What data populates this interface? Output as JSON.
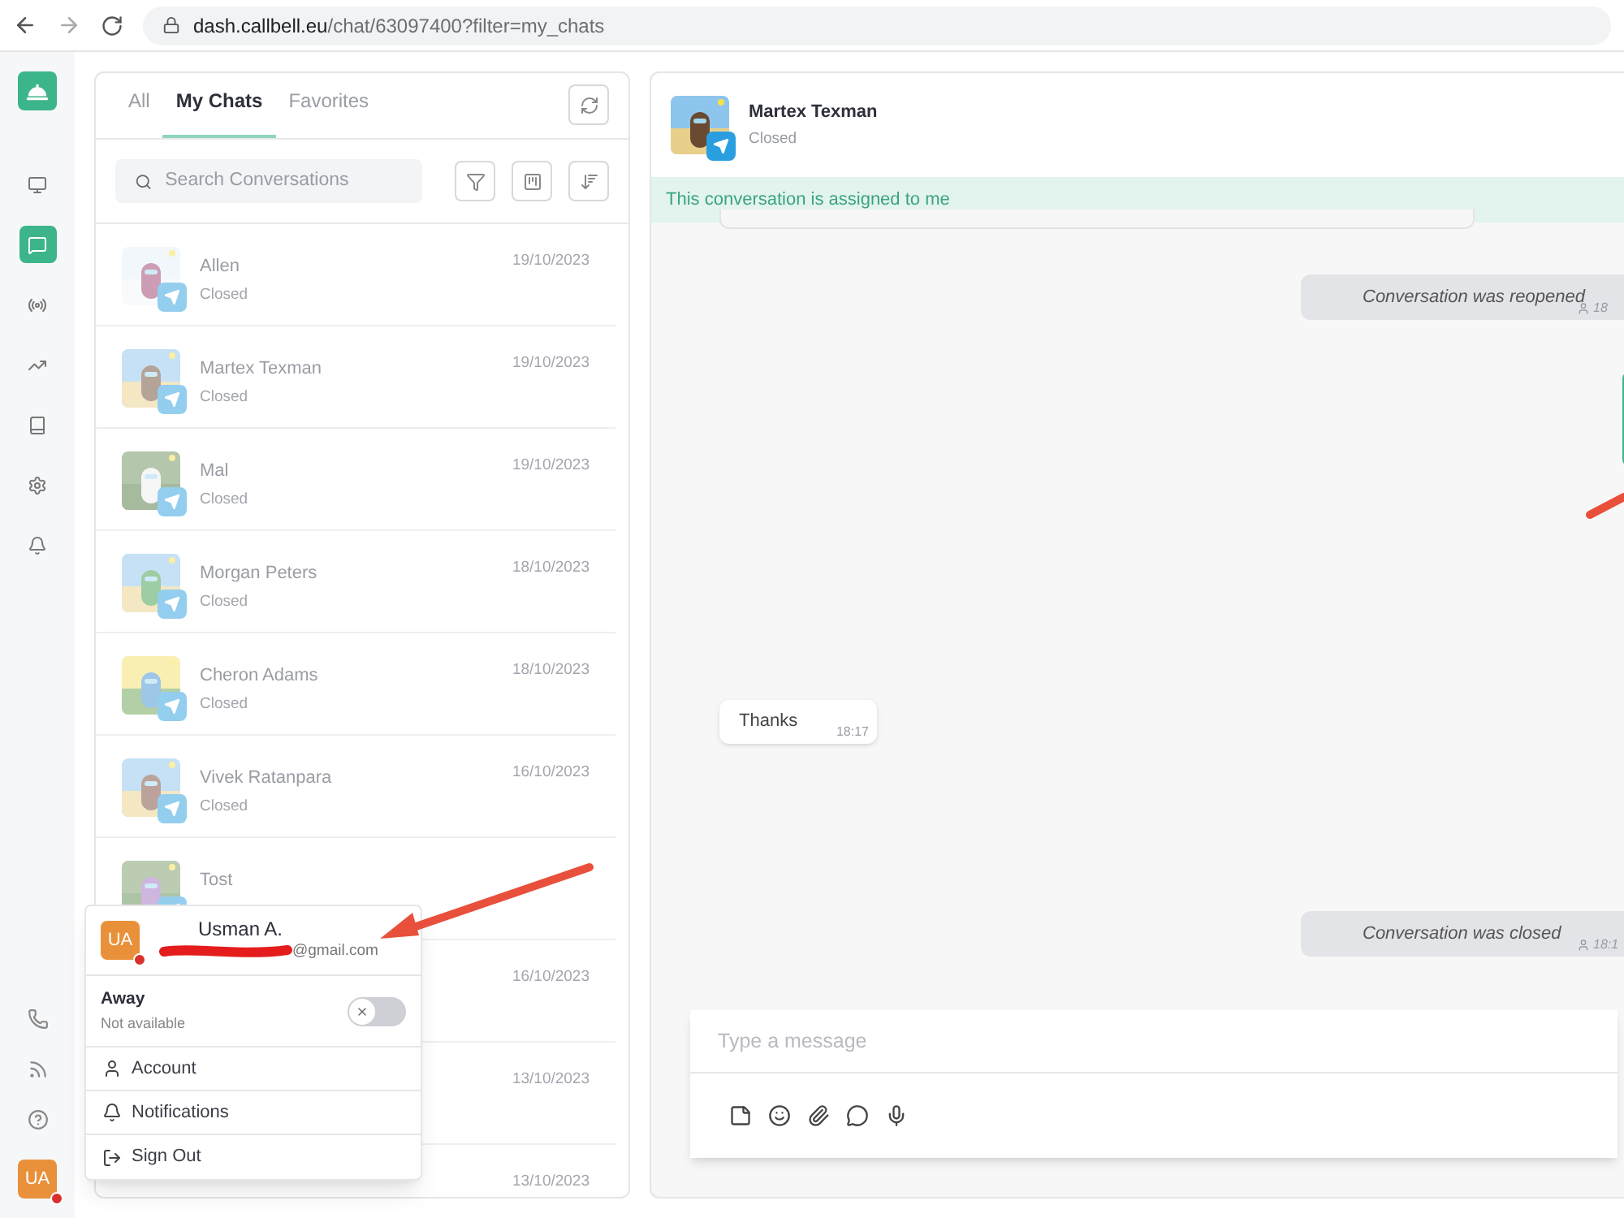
{
  "browser": {
    "url_host": "dash.callbell.eu",
    "url_path": "/chat/63097400?filter=my_chats"
  },
  "nav": {
    "top": [
      {
        "kind": "monitor",
        "selected": false
      },
      {
        "kind": "chat",
        "selected": true
      },
      {
        "kind": "broadcast",
        "selected": false
      },
      {
        "kind": "trend",
        "selected": false
      },
      {
        "kind": "book",
        "selected": false
      },
      {
        "kind": "settings",
        "selected": false
      },
      {
        "kind": "bell",
        "selected": false
      }
    ],
    "bottom": [
      {
        "kind": "whatsapp"
      },
      {
        "kind": "rss"
      },
      {
        "kind": "help"
      }
    ],
    "avatar_initials": "UA"
  },
  "tabs": [
    {
      "label": "All",
      "selected": false
    },
    {
      "label": "My Chats",
      "selected": true
    },
    {
      "label": "Favorites",
      "selected": false
    }
  ],
  "search": {
    "placeholder": "Search Conversations"
  },
  "chats": [
    {
      "name": "Allen",
      "status": "Closed",
      "date": "19/10/2023"
    },
    {
      "name": "Martex Texman",
      "status": "Closed",
      "date": "19/10/2023"
    },
    {
      "name": "Mal",
      "status": "Closed",
      "date": "19/10/2023"
    },
    {
      "name": "Morgan Peters",
      "status": "Closed",
      "date": "18/10/2023"
    },
    {
      "name": "Cheron Adams",
      "status": "Closed",
      "date": "18/10/2023"
    },
    {
      "name": "Vivek Ratanpara",
      "status": "Closed",
      "date": "16/10/2023"
    },
    {
      "name": "Tost"
    },
    {
      "date": "16/10/2023"
    },
    {
      "date": "13/10/2023"
    },
    {
      "date": "13/10/2023"
    }
  ],
  "conversation": {
    "name": "Martex Texman",
    "status": "Closed",
    "banner": "This conversation is assigned to me",
    "messages": [
      {
        "kind": "event",
        "text": "Conversation was reopened",
        "time": "18"
      },
      {
        "kind": "incoming",
        "text": "Thanks",
        "time": "18:17"
      },
      {
        "kind": "event",
        "text": "Conversation was closed",
        "time": "18:1"
      }
    ],
    "composer": {
      "placeholder": "Type a message"
    }
  },
  "user_menu": {
    "initials": "UA",
    "name": "Usman A.",
    "email_visible": "@gmail.com",
    "status": {
      "label": "Away",
      "sub": "Not available",
      "on": false
    },
    "items": [
      {
        "kind": "account",
        "label": "Account"
      },
      {
        "kind": "notifications",
        "label": "Notifications"
      },
      {
        "kind": "signout",
        "label": "Sign Out"
      }
    ]
  }
}
